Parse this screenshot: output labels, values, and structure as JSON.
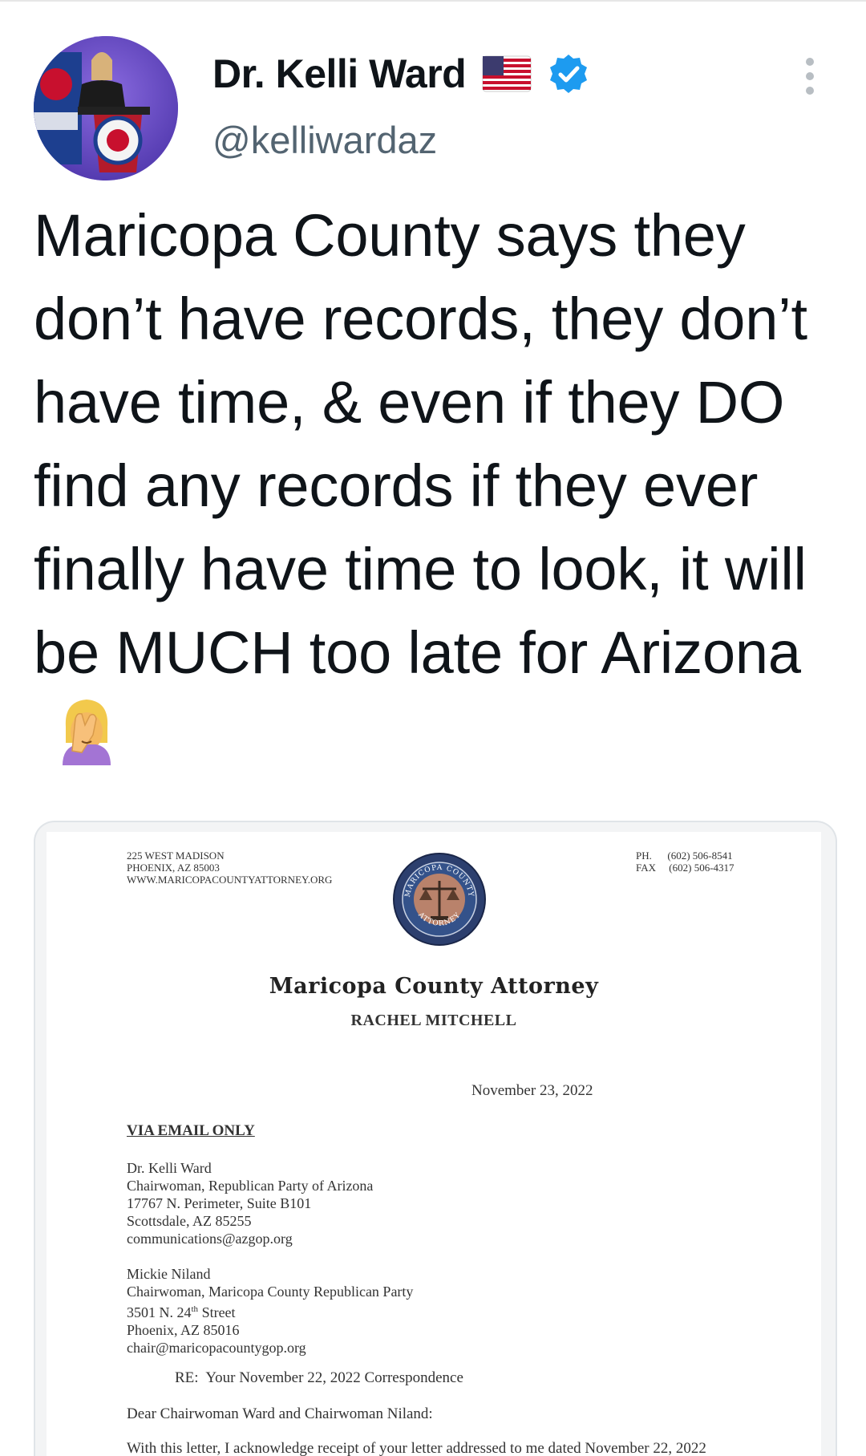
{
  "header": {
    "name": "Dr. Kelli Ward",
    "handle": "@kelliwardaz"
  },
  "tweet": {
    "text": "Maricopa County says they don’t have records, they don’t have time, & even if they DO find any records if they ever finally have time to look, it will be MUCH too late for Arizona"
  },
  "icons": {
    "flag": "us-flag-icon",
    "verified": "verified-badge-icon",
    "more": "more-options-icon",
    "emoji": "facepalm-emoji-icon"
  },
  "colors": {
    "verified_blue": "#1d9bf0",
    "text_primary": "#0f1419",
    "text_secondary": "#536471"
  },
  "letter": {
    "address_lines": [
      "225 WEST MADISON",
      "PHOENIX, AZ 85003",
      "WWW.MARICOPACOUNTYATTORNEY.ORG"
    ],
    "phone": "PH.      (602) 506-8541",
    "fax": "FAX     (602) 506-4317",
    "seal_text_top": "MARICOPA COUNTY",
    "seal_text_bottom": "ATTORNEY",
    "office": "Maricopa County Attorney",
    "attorney_name": "RACHEL MITCHELL",
    "date": "November 23, 2022",
    "delivery": "VIA EMAIL ONLY",
    "recipient1": {
      "name": "Dr. Kelli Ward",
      "title": "Chairwoman, Republican Party of Arizona",
      "street": "17767 N. Perimeter, Suite B101",
      "city": "Scottsdale, AZ 85255",
      "email": "communications@azgop.org"
    },
    "recipient2": {
      "name": "Mickie Niland",
      "title": "Chairwoman, Maricopa County Republican Party",
      "street_prefix": "3501 N. 24",
      "street_sup": "th",
      "street_suffix": " Street",
      "city": "Phoenix, AZ 85016",
      "email": "chair@maricopacountygop.org"
    },
    "re_line": "RE:  Your November 22, 2022 Correspondence",
    "salutation": "Dear Chairwoman Ward and Chairwoman Niland:",
    "body_start": "With this letter, I acknowledge receipt of your letter addressed to me dated November 22, 2022"
  }
}
